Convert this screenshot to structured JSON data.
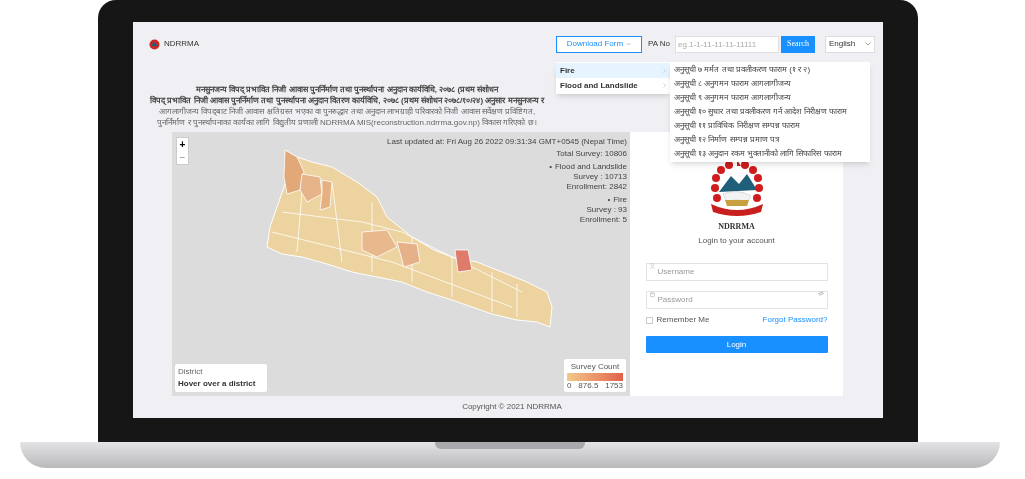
{
  "header": {
    "logo_text": "NDRRMA",
    "download_button": "Download Form",
    "pa_label": "PA No",
    "pa_placeholder": "eg.1-1-11-11-11-11111",
    "search_button": "Search",
    "language": "English"
  },
  "dropdown": {
    "items": [
      {
        "label": "Fire",
        "selected": true
      },
      {
        "label": "Flood and Landslide",
        "selected": false
      }
    ],
    "submenu": [
      "अनुसूची ७ मर्मत तथा प्रवलीकरण फाराम (१ र २)",
      "अनुसूची ८ अनुगमन फाराम आगलागीजन्य",
      "अनुसूची ९ अनुगमन फाराम आगलागीजन्य",
      "अनुसूची १० सुधार तथा प्रवलीकरण गर्न आदेश निरीक्षण फाराम",
      "अनुसूची ११ प्राविधिक निरीक्षण सम्पन्न फाराम",
      "अनुसूची १२ निर्माण सम्पन्न प्रमाण पत्र",
      "अनुसूची १३ अनुदान रकम भुक्तानीको लागि सिफारिस फाराम"
    ]
  },
  "notice": [
    "मनसुनजन्य विपद्‌ प्रभावित निजी आवास पुनर्निर्माण तथा पुनर्स्थापना अनुदान कार्यविधि, २०७८ (प्रथम संशोधन",
    "विपद्‌ प्रभावित निजी आवास पुनर्निर्माण तथा पुनर्स्थापना अनुदान वितरण कार्यविधि, २०७८ (प्रथम संशोधन २०७८/१०/२४) अनुसार मनसुनजन्य र",
    "आगलागीजन्य विपद्‌बाट निजी आवास क्षतिग्रस्त भएका वा पुनरुद्धार तथा अनुदान लाभग्राही परिवारको निजी आवास सर्वेक्षण प्रविष्टिगत,",
    "पुनर्निर्माण र पुनर्स्थापनाका कार्यका लागि विद्युतीय प्रणाली NDRRMA MIS(reconstruction.ndrrma.gov.np) विकास गरिएको छ।"
  ],
  "map": {
    "zoom": [
      {
        "label": "+",
        "disabled": false
      },
      {
        "label": "−",
        "disabled": true
      }
    ],
    "last_updated": "Last updated at: Fri Aug 26 2022 09:31:34 GMT+0545 (Nepal Time)",
    "total_survey": "Total Survey: 10806",
    "groups": [
      {
        "marker": "•",
        "name": "Flood and Landslide",
        "survey": "Survey : 10713",
        "enrollment": "Enrollment: 2842"
      },
      {
        "marker": "•",
        "name": "Fire",
        "survey": "Survey : 93",
        "enrollment": "Enrollment: 5"
      }
    ],
    "district_label": "District",
    "district_hint": "Hover over a district",
    "legend": {
      "title": "Survey Count",
      "ticks": [
        "0",
        "876.5",
        "1753"
      ]
    }
  },
  "login": {
    "org": "NDRRMA",
    "subtitle": "Login to your account",
    "username_placeholder": "Username",
    "password_placeholder": "Password",
    "remember": {
      "label": "Remember Me",
      "checked": false
    },
    "forgot": "Forgot Password?",
    "button": "Login"
  },
  "footer": "Copyright © 2021 NDRRMA"
}
